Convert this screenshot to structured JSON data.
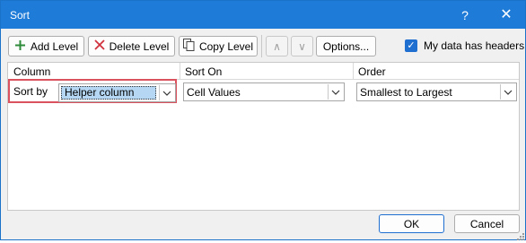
{
  "window": {
    "title": "Sort",
    "help_glyph": "?",
    "close_glyph": "✕"
  },
  "toolbar": {
    "add_level": "Add Level",
    "delete_level": "Delete Level",
    "copy_level": "Copy Level",
    "move_up": "∧",
    "move_down": "∨",
    "options": "Options..."
  },
  "headers_checkbox": {
    "label": "My data has headers",
    "checked": true
  },
  "grid": {
    "columns": [
      "Column",
      "Sort On",
      "Order"
    ],
    "rows": [
      {
        "label": "Sort by",
        "column": "Helper column",
        "sort_on": "Cell Values",
        "order": "Smallest to Largest"
      }
    ]
  },
  "footer": {
    "ok": "OK",
    "cancel": "Cancel"
  },
  "colors": {
    "titlebar": "#1f7bd8",
    "accent": "#1f6fd1",
    "highlight_border": "#d9525e",
    "selection": "#b5d7f3"
  }
}
